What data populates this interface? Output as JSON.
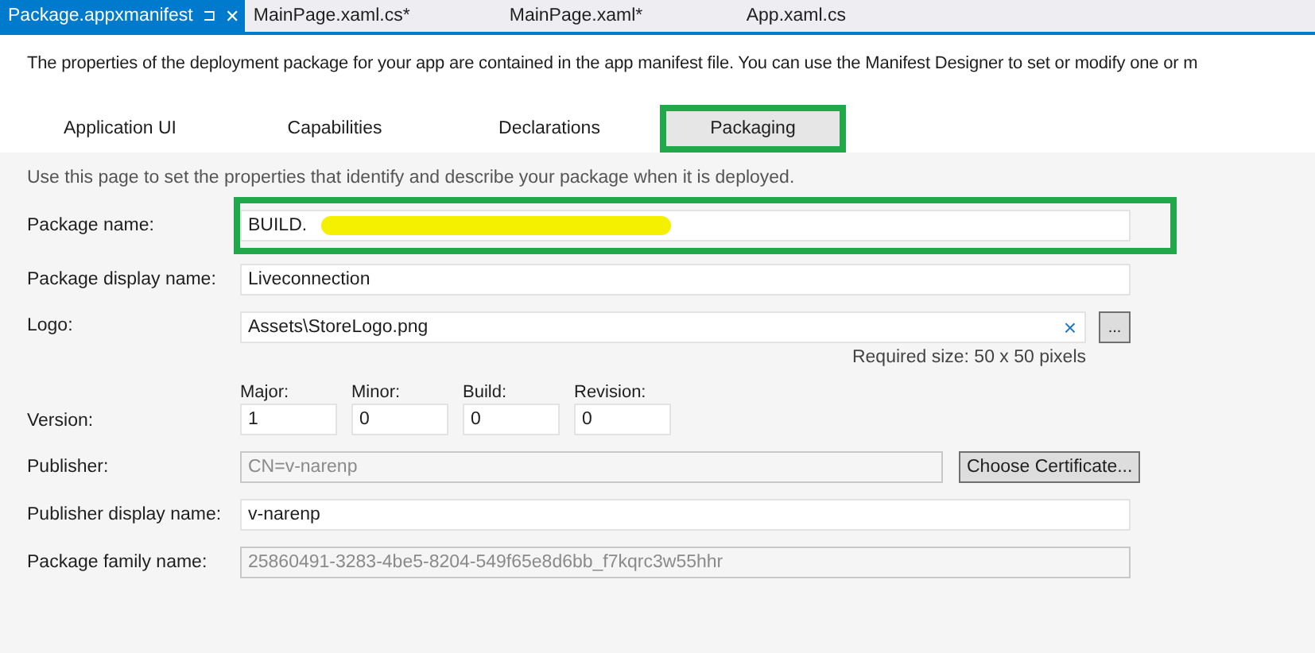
{
  "doc_tabs": [
    {
      "label": "Package.appxmanifest",
      "selected": true,
      "pin": "⊐",
      "close": "✕"
    },
    {
      "label": "MainPage.xaml.cs*",
      "selected": false
    },
    {
      "label": "MainPage.xaml*",
      "selected": false
    },
    {
      "label": "App.xaml.cs",
      "selected": false
    }
  ],
  "intro": "The properties of the deployment package for your app are contained in the app manifest file. You can use the Manifest Designer to set or modify one or m",
  "tabs": [
    {
      "label": "Application UI",
      "selected": false,
      "highlighted": false
    },
    {
      "label": "Capabilities",
      "selected": false,
      "highlighted": false
    },
    {
      "label": "Declarations",
      "selected": false,
      "highlighted": false
    },
    {
      "label": "Packaging",
      "selected": true,
      "highlighted": true
    }
  ],
  "hint": "Use this page to set the properties that identify and describe your package when it is deployed.",
  "fields": [
    {
      "kind": "text",
      "label": "Package name:",
      "value": "BUILD.",
      "redacted": true,
      "highlighted": true,
      "disabled": false
    },
    {
      "kind": "text",
      "label": "Package display name:",
      "value": "Liveconnection",
      "disabled": false
    },
    {
      "kind": "logo",
      "label": "Logo:",
      "value": "Assets\\StoreLogo.png",
      "clear": "×",
      "browse": "...",
      "note": "Required size: 50 x 50 pixels"
    },
    {
      "kind": "version",
      "label": "Version:",
      "parts": [
        {
          "label": "Major:",
          "value": "1"
        },
        {
          "label": "Minor:",
          "value": "0"
        },
        {
          "label": "Build:",
          "value": "0"
        },
        {
          "label": "Revision:",
          "value": "0"
        }
      ]
    },
    {
      "kind": "publisher",
      "label": "Publisher:",
      "value": "CN=v-narenp",
      "disabled": true,
      "button": "Choose Certificate..."
    },
    {
      "kind": "text",
      "label": "Publisher display name:",
      "value": "v-narenp",
      "disabled": false
    },
    {
      "kind": "text",
      "label": "Package family name:",
      "value": "25860491-3283-4be5-8204-549f65e8d6bb_f7kqrc3w55hhr",
      "disabled": true
    }
  ]
}
